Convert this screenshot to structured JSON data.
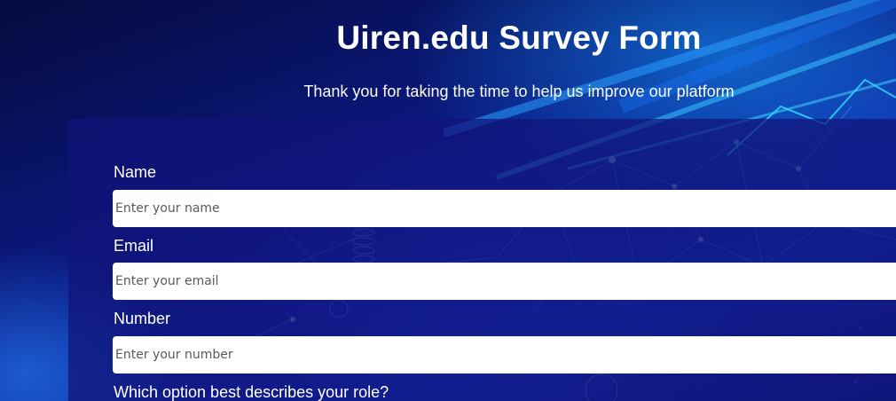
{
  "page": {
    "title": "Uiren.edu Survey Form",
    "subtitle": "Thank you for taking the time to help us improve our platform"
  },
  "form": {
    "name": {
      "label": "Name",
      "placeholder": "Enter your name",
      "value": ""
    },
    "email": {
      "label": "Email",
      "placeholder": "Enter your email",
      "value": ""
    },
    "number": {
      "label": "Number",
      "placeholder": "Enter your number",
      "value": ""
    },
    "role": {
      "label": "Which option best describes your role?"
    }
  },
  "colors": {
    "background": "#0a0f5c",
    "accent": "#22d3ee",
    "text": "#ffffff",
    "input_background": "#ffffff"
  }
}
